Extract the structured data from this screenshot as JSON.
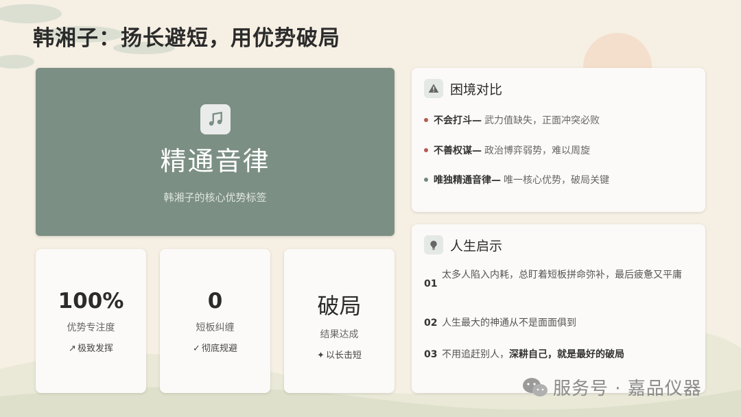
{
  "title": "韩湘子：扬长避短，用优势破局",
  "hero": {
    "icon": "music-note-icon",
    "title": "精通音律",
    "subtitle": "韩湘子的核心优势标签"
  },
  "stats": [
    {
      "value": "100%",
      "label": "优势专注度",
      "tag_icon": "trend-up-icon",
      "tag": "极致发挥"
    },
    {
      "value": "0",
      "label": "短板纠缠",
      "tag_icon": "check-icon",
      "tag": "彻底规避"
    },
    {
      "value": "破局",
      "label": "结果达成",
      "tag_icon": "magic-wand-icon",
      "tag": "以长击短"
    }
  ],
  "dilemma": {
    "icon": "warning-icon",
    "title": "困境对比",
    "items": [
      {
        "key": "不会打斗—",
        "text": "武力值缺失，正面冲突必败",
        "dot_color": "#b55a55"
      },
      {
        "key": "不善权谋—",
        "text": "政治博弈弱势，难以周旋",
        "dot_color": "#b55a55"
      },
      {
        "key": "唯独精通音律—",
        "text": "唯一核心优势，破局关键",
        "dot_color": "#6f8a7a"
      }
    ]
  },
  "insight": {
    "icon": "lightbulb-icon",
    "title": "人生启示",
    "items": [
      {
        "num": "01",
        "text": "太多人陷入内耗，总盯着短板拼命弥补，最后疲惫又平庸",
        "bold": ""
      },
      {
        "num": "02",
        "text": "人生最大的神通从不是面面俱到",
        "bold": ""
      },
      {
        "num": "03",
        "text": "不用追赶别人，",
        "bold": "深耕自己，就是最好的破局"
      }
    ]
  },
  "watermark": "服务号 · 嘉品仪器",
  "colors": {
    "hero_bg": "#7c8f84",
    "bg": "#f6efe3"
  }
}
